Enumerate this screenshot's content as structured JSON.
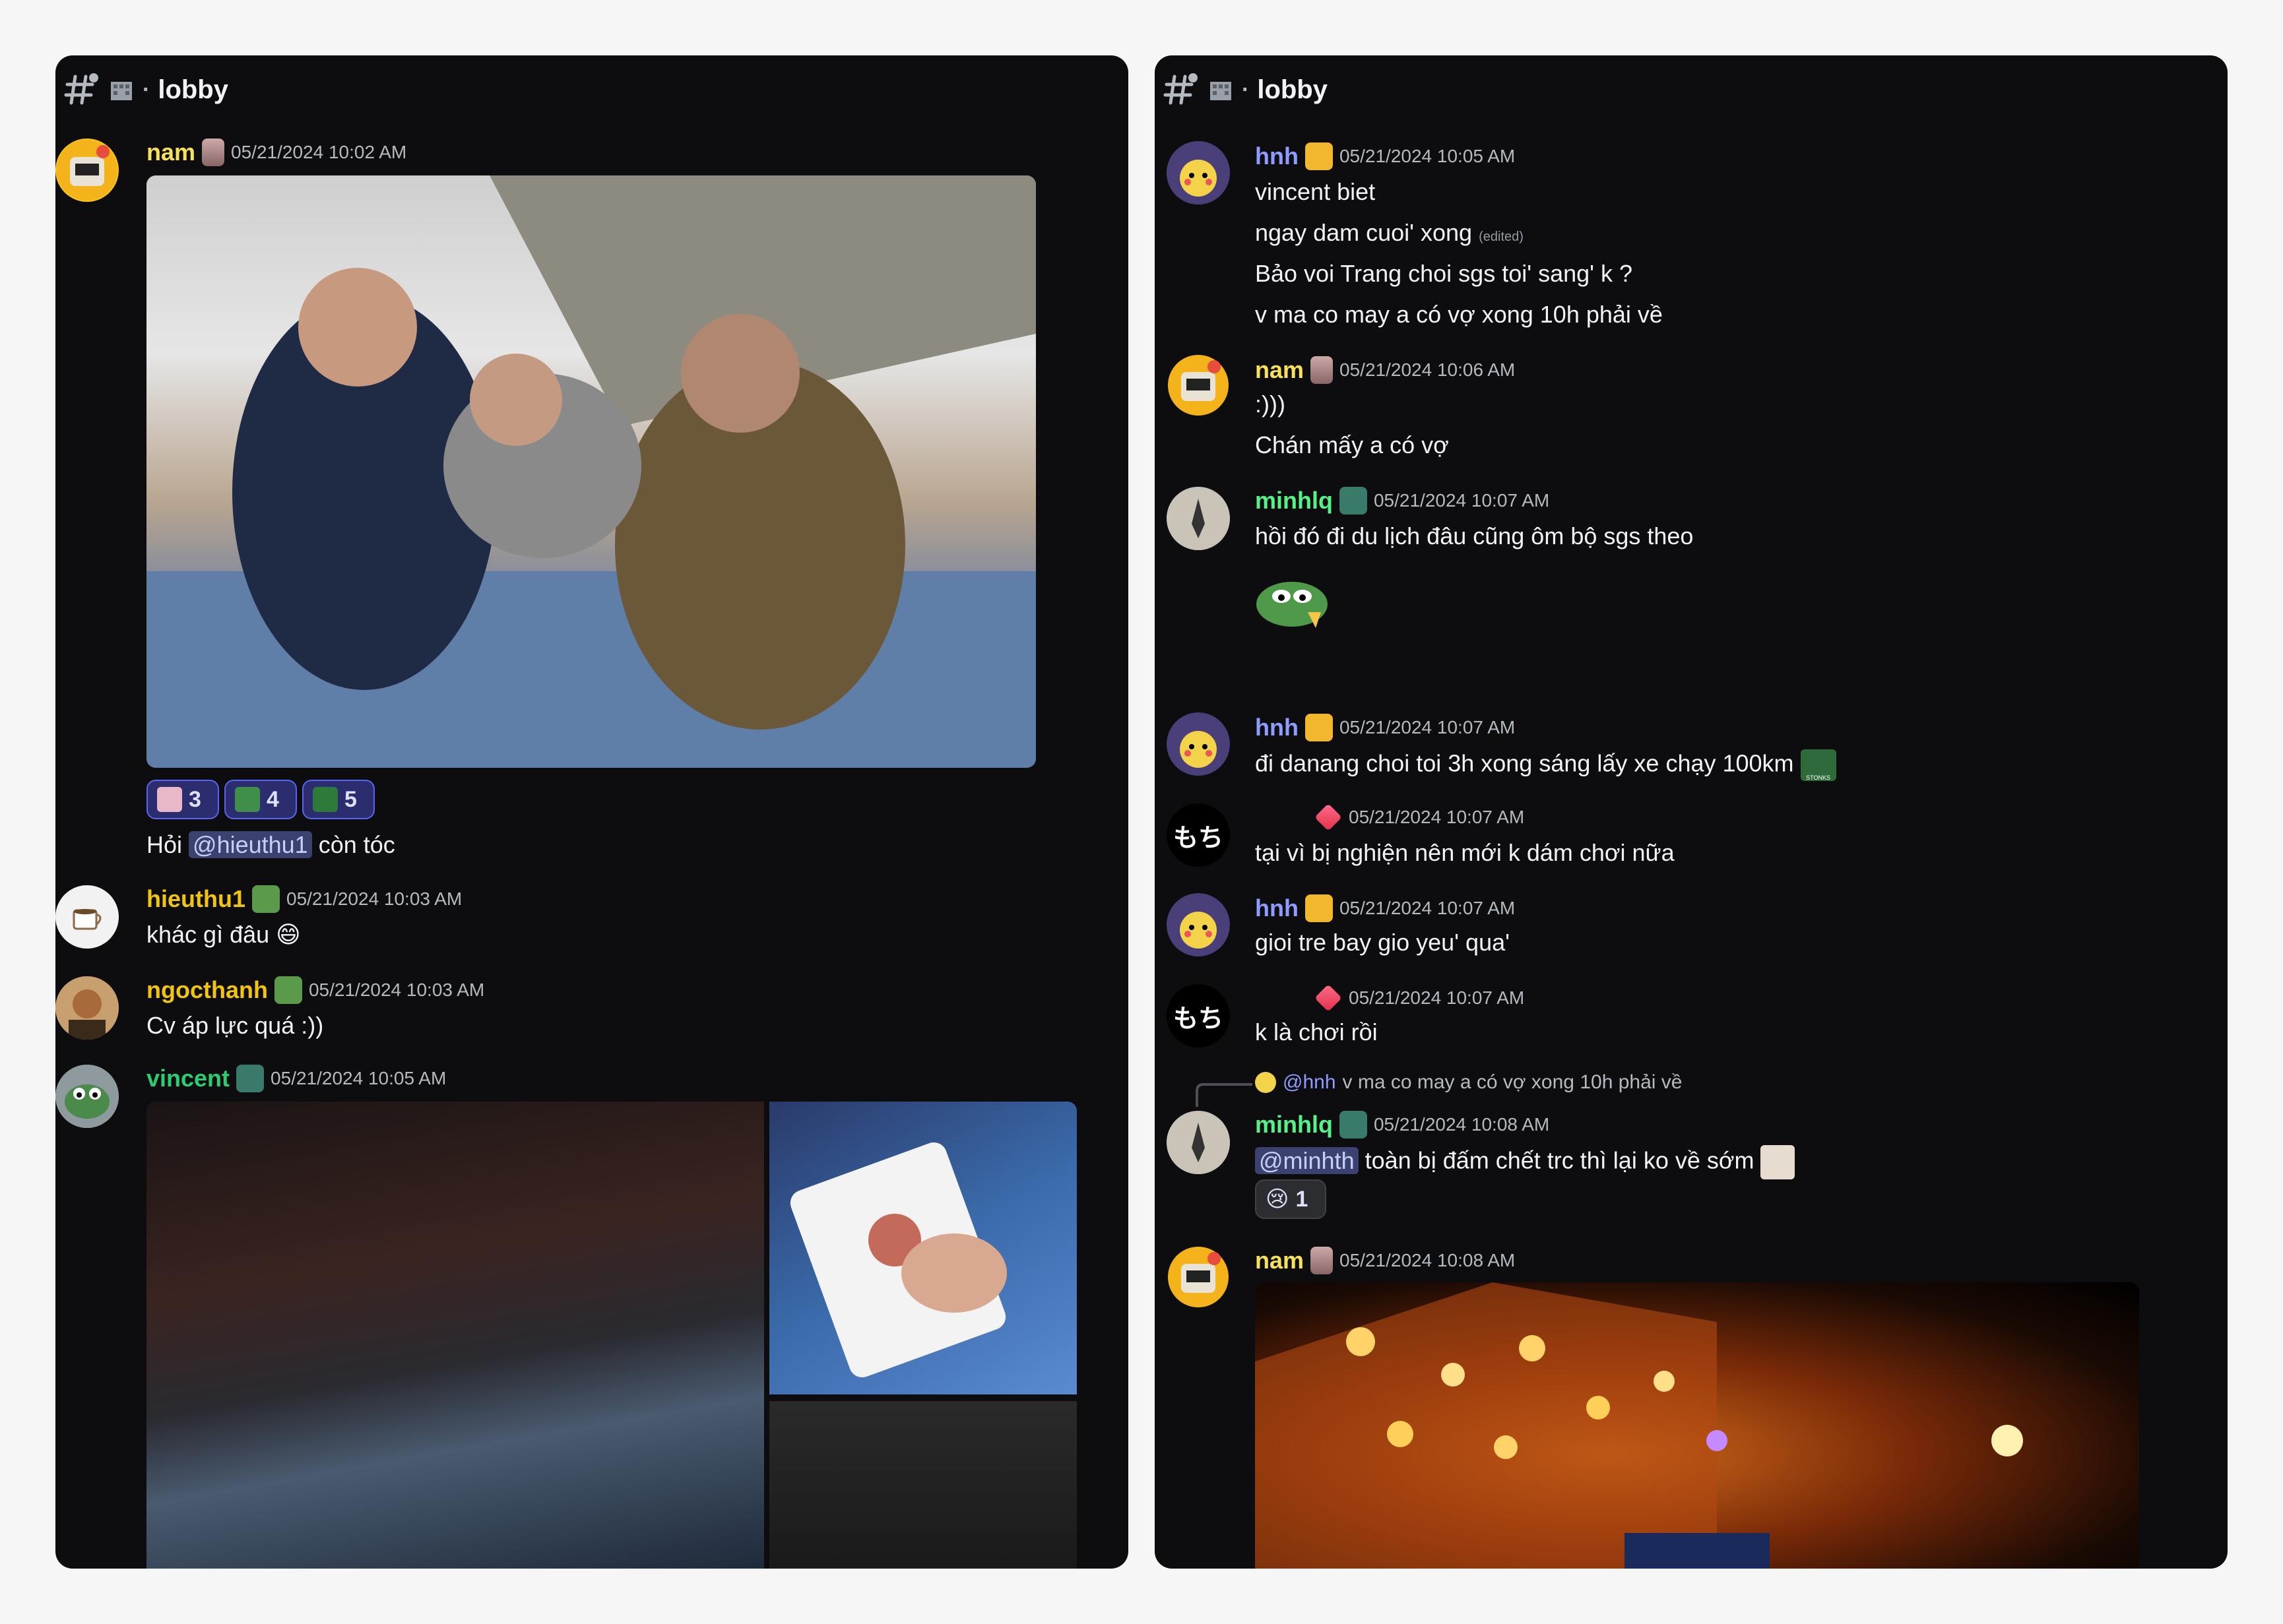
{
  "left": {
    "channel": "lobby",
    "messages": [
      {
        "user": "nam",
        "time": "05/21/2024 10:02 AM",
        "reactions": [
          {
            "count": "3"
          },
          {
            "count": "4"
          },
          {
            "count": "5"
          }
        ],
        "text_before": "Hỏi ",
        "mention": "@hieuthu1",
        "text_after": " còn tóc"
      },
      {
        "user": "hieuthu1",
        "time": "05/21/2024 10:03 AM",
        "text": "khác gì đâu",
        "emoji": "😄"
      },
      {
        "user": "ngocthanh",
        "time": "05/21/2024 10:03 AM",
        "text": "Cv áp lực quá :))"
      },
      {
        "user": "vincent",
        "time": "05/21/2024 10:05 AM"
      }
    ]
  },
  "right": {
    "channel": "lobby",
    "messages": [
      {
        "user": "hnh",
        "time": "05/21/2024 10:05 AM",
        "lines": [
          "vincent biet",
          "ngay dam cuoi' xong",
          "Bảo voi Trang choi sgs toi' sang' k ?",
          "v ma co may a có vợ xong 10h phải về"
        ],
        "edited": "(edited)"
      },
      {
        "user": "nam",
        "time": "05/21/2024 10:06 AM",
        "lines": [
          ":)))",
          "Chán mấy a có vợ"
        ]
      },
      {
        "user": "minhlq",
        "time": "05/21/2024 10:07 AM",
        "lines": [
          "hồi đó đi du lịch đâu cũng ôm bộ sgs theo"
        ]
      },
      {
        "user": "hnh",
        "time": "05/21/2024 10:07 AM",
        "lines": [
          "đi danang choi toi 3h xong sáng lấy xe chạy 100km"
        ],
        "sticker_label": "STONKS"
      },
      {
        "user": "",
        "time": "05/21/2024 10:07 AM",
        "avatar_text": "もち",
        "lines": [
          "tại vì bị nghiện nên mới k dám chơi nữa"
        ]
      },
      {
        "user": "hnh",
        "time": "05/21/2024 10:07 AM",
        "lines": [
          "gioi tre bay gio yeu' qua'"
        ]
      },
      {
        "user": "",
        "time": "05/21/2024 10:07 AM",
        "avatar_text": "もち",
        "lines": [
          "k là chơi rồi"
        ]
      },
      {
        "user": "minhlq",
        "time": "05/21/2024 10:08 AM",
        "reply_user": "@hnh",
        "reply_text": "v ma co may a có vợ xong 10h phải về",
        "mention": "@minhth",
        "text": " toàn bị đấm chết trc thì lại ko về sớm",
        "reaction": {
          "emoji": "😢",
          "count": "1"
        }
      },
      {
        "user": "nam",
        "time": "05/21/2024 10:08 AM"
      }
    ]
  },
  "colors": {
    "background": "#0d0d0f",
    "page": "#f6f6f7",
    "nam": "#f7e05a",
    "hieuthu1": "#f1c40f",
    "ngocthanh": "#f1c40f",
    "vincent": "#2ecc71",
    "hnh": "#8f9cff",
    "minhlq": "#57f287",
    "mention_bg": "#3c4270",
    "reaction_border": "#5865f2"
  },
  "icons": [
    "text-channel-icon",
    "house-icon",
    "crown-icon",
    "gem-icon",
    "frog-badge-icon",
    "rabbit-badge-icon"
  ]
}
